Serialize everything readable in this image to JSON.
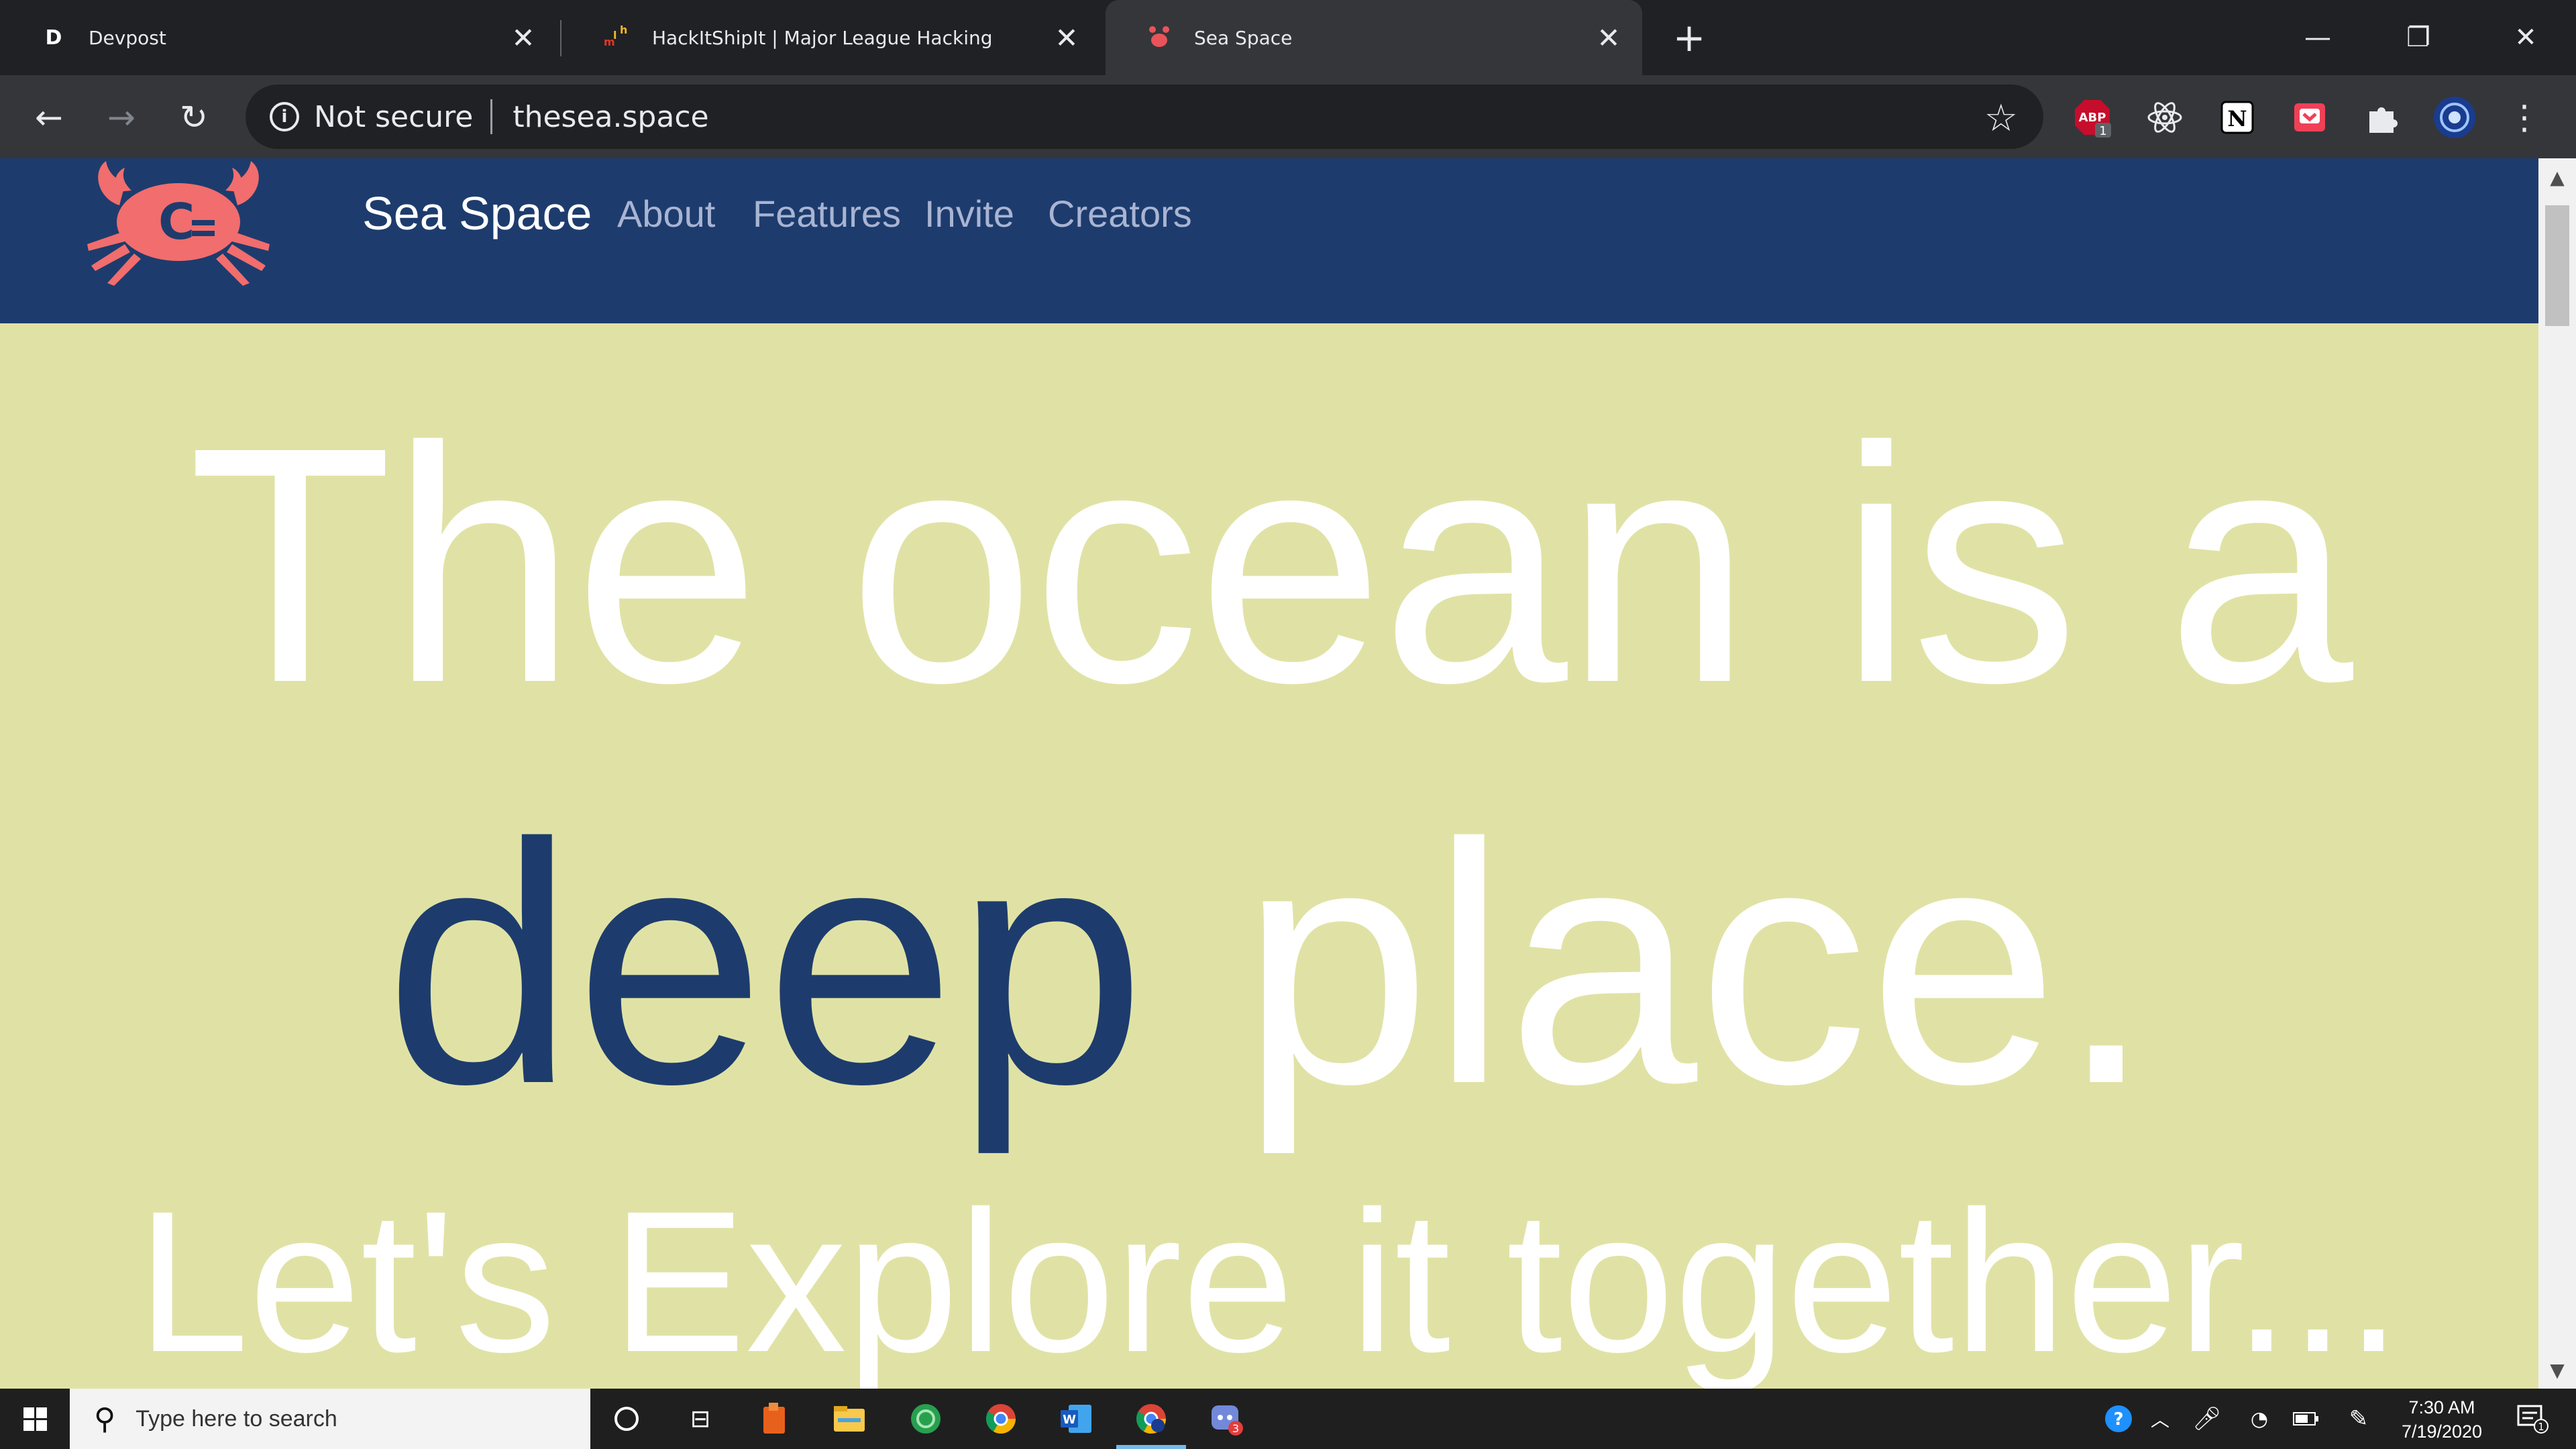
{
  "browser": {
    "tabs": [
      {
        "title": "Devpost",
        "favicon_letter": "D"
      },
      {
        "title": "HackItShipIt | Major League Hacking",
        "favicon_letter": "mlh"
      },
      {
        "title": "Sea Space",
        "favicon_letter": ""
      }
    ],
    "new_tab_symbol": "+",
    "window_controls": {
      "minimize": "—",
      "restore": "❐",
      "close": "✕"
    },
    "toolbar": {
      "back": "←",
      "forward": "→",
      "reload": "↻"
    },
    "omnibox": {
      "security_label": "Not secure",
      "url": "thesea.space",
      "info_glyph": "i"
    },
    "extensions": [
      {
        "icon": "abp-icon",
        "badge": "1"
      },
      {
        "icon": "react-devtools-icon"
      },
      {
        "icon": "notion-icon",
        "glyph": "N"
      },
      {
        "icon": "pocket-icon"
      },
      {
        "icon": "extensions-puzzle-icon"
      },
      {
        "icon": "profile-avatar-icon"
      },
      {
        "icon": "menu-kebab-icon"
      }
    ]
  },
  "site": {
    "brand": "Sea Space",
    "logo_text": "C",
    "nav": [
      "About",
      "Features",
      "Invite",
      "Creators"
    ],
    "hero": {
      "line1": "The ocean is a",
      "line2_highlight": "deep",
      "line2_rest": "place.",
      "line3": "Let's Explore it together..."
    },
    "colors": {
      "navbar": "#1d3c6d",
      "background": "#e0e2a5",
      "highlight": "#1d3c6d",
      "logo": "#f26d6d"
    }
  },
  "taskbar": {
    "search_placeholder": "Type here to search",
    "time": "7:30 AM",
    "date": "7/19/2020",
    "notification_count": "1",
    "discord_badge": "3"
  }
}
